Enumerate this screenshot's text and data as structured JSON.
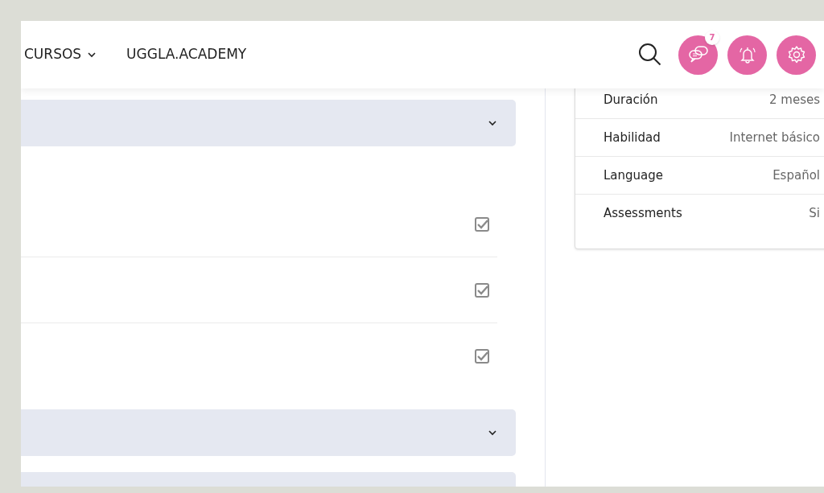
{
  "nav": {
    "menu": "CURSOS",
    "site": "UGGLA.ACADEMY",
    "messages_badge": "7"
  },
  "sections": [
    {
      "kind": "open",
      "lessons": [
        {
          "checked": true
        },
        {
          "checked": true
        },
        {
          "checked": true
        }
      ]
    },
    {
      "kind": "closed"
    },
    {
      "kind": "closed"
    }
  ],
  "details": [
    {
      "label": "Duración",
      "value": "2 meses"
    },
    {
      "label": "Habilidad",
      "value": "Internet básico"
    },
    {
      "label": "Language",
      "value": "Español"
    },
    {
      "label": "Assessments",
      "value": "Si"
    }
  ]
}
